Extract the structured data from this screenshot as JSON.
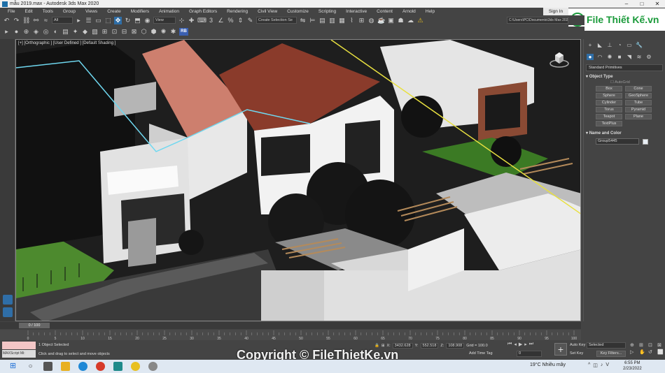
{
  "window": {
    "title": "mẫu 2019.max - Autodesk 3ds Max 2020"
  },
  "menu": [
    "File",
    "Edit",
    "Tools",
    "Group",
    "Views",
    "Create",
    "Modifiers",
    "Animation",
    "Graph Editors",
    "Rendering",
    "Civil View",
    "Customize",
    "Scripting",
    "Interactive",
    "Content",
    "Arnold",
    "Help"
  ],
  "account": {
    "sign_in": "Sign In"
  },
  "watermark_logo": "File Thiết Kế.vn",
  "toolbar": {
    "filter_dropdown": "All",
    "view_dropdown": "View",
    "snap_label": "3",
    "selection_set": "Create Selection Se",
    "project_path": "C:\\Users\\PC\\Documents\\3ds Max 2020",
    "rb_badge": "RB"
  },
  "viewport": {
    "label": "[+] [Orthographic ] [User Defined ] [Default Shading ]"
  },
  "command_panel": {
    "category": "Standard Primitives",
    "object_type_title": "Object Type",
    "autogrid": "AutoGrid",
    "object_types": [
      "Box",
      "Cone",
      "Sphere",
      "GeoSphere",
      "Cylinder",
      "Tube",
      "Torus",
      "Pyramid",
      "Teapot",
      "Plane",
      "TextPlus"
    ],
    "name_color_title": "Name and Color",
    "object_name": "Group5445",
    "object_color": "#e8eef4"
  },
  "timeline": {
    "frame_slider": "0 / 100",
    "ticks": [
      "0",
      "5",
      "10",
      "15",
      "20",
      "25",
      "30",
      "35",
      "40",
      "45",
      "50",
      "55",
      "60",
      "65",
      "70",
      "75",
      "80",
      "85",
      "90",
      "95",
      "100"
    ]
  },
  "status": {
    "maxscript_label": "MAXScript Mi:",
    "selection_info": "1 Object Selected",
    "prompt": "Click and drag to select and move objects",
    "x_label": "X:",
    "x_value": "3432.628",
    "y_label": "Y:",
    "y_value": "552.518",
    "z_label": "Z:",
    "z_value": "108.908",
    "grid": "Grid = 100.0",
    "add_time_tag": "Add Time Tag",
    "current_frame": "0",
    "auto_key": "Auto Key",
    "set_key": "Set Key",
    "selected_dropdown": "Selected",
    "key_filters": "Key Filters..."
  },
  "copyright": "Copyright © FileThietKe.vn",
  "taskbar": {
    "weather": "19°C  Nhiều mây",
    "time": "6:55 PM",
    "date": "2/23/2022"
  }
}
